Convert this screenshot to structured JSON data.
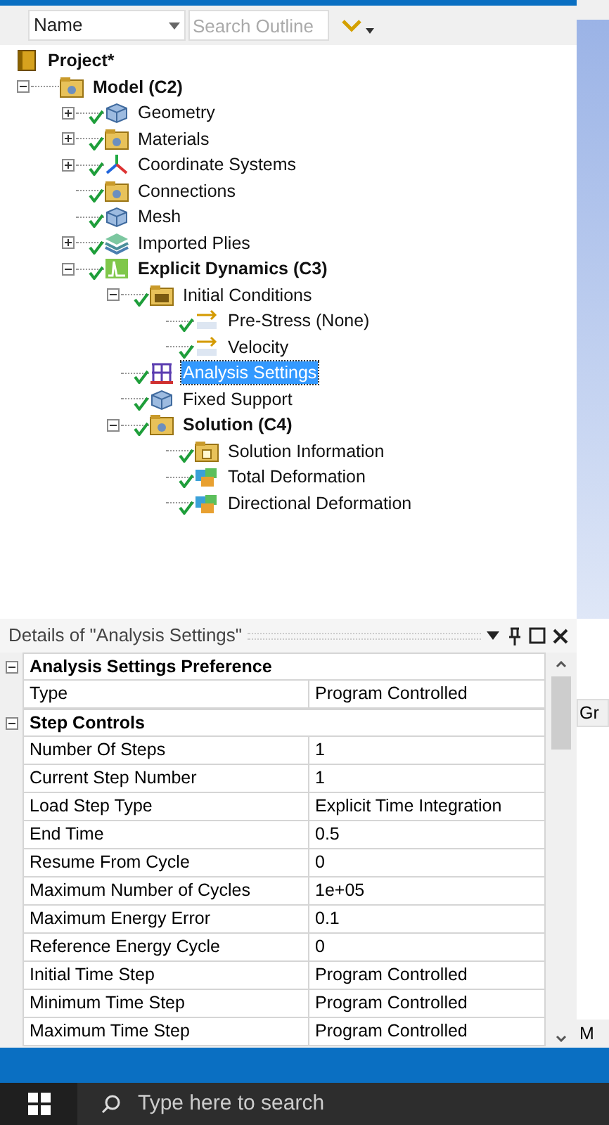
{
  "toolbar": {
    "sort_field": "Name",
    "search": {
      "placeholder": "Search Outline"
    }
  },
  "tree": [
    {
      "label": "Project*",
      "kind": "project",
      "checked": false,
      "selected": false,
      "children": [
        {
          "label": "Model (C2)",
          "kind": "model",
          "checked": false,
          "selected": false,
          "expanded": true,
          "children": [
            {
              "label": "Geometry",
              "kind": "geometry",
              "checked": true,
              "selected": false,
              "expanded": false
            },
            {
              "label": "Materials",
              "kind": "materials",
              "checked": true,
              "selected": false,
              "expanded": false
            },
            {
              "label": "Coordinate Systems",
              "kind": "coordinates",
              "checked": true,
              "selected": false,
              "expanded": false
            },
            {
              "label": "Connections",
              "kind": "connections",
              "checked": true,
              "selected": false
            },
            {
              "label": "Mesh",
              "kind": "mesh",
              "checked": true,
              "selected": false
            },
            {
              "label": "Imported Plies",
              "kind": "plies",
              "checked": true,
              "selected": false,
              "expanded": false
            },
            {
              "label": "Explicit Dynamics (C3)",
              "kind": "analysis",
              "checked": true,
              "selected": false,
              "expanded": true,
              "children": [
                {
                  "label": "Initial Conditions",
                  "kind": "conditions",
                  "checked": true,
                  "selected": false,
                  "expanded": true,
                  "children": [
                    {
                      "label": "Pre-Stress (None)",
                      "kind": "initial",
                      "checked": true,
                      "selected": false
                    },
                    {
                      "label": "Velocity",
                      "kind": "initial",
                      "checked": true,
                      "selected": false
                    }
                  ]
                },
                {
                  "label": "Analysis Settings",
                  "kind": "settings",
                  "checked": true,
                  "selected": true
                },
                {
                  "label": "Fixed Support",
                  "kind": "support",
                  "checked": true,
                  "selected": false
                },
                {
                  "label": "Solution (C4)",
                  "kind": "solution",
                  "checked": true,
                  "selected": false,
                  "expanded": true,
                  "children": [
                    {
                      "label": "Solution Information",
                      "kind": "info",
                      "checked": true,
                      "selected": false
                    },
                    {
                      "label": "Total Deformation",
                      "kind": "result",
                      "checked": true,
                      "selected": false
                    },
                    {
                      "label": "Directional Deformation",
                      "kind": "result",
                      "checked": true,
                      "selected": false
                    }
                  ]
                }
              ]
            }
          ]
        }
      ]
    }
  ],
  "details": {
    "title": "Details of \"Analysis Settings\"",
    "groups": [
      {
        "title": "Analysis Settings Preference",
        "expanded": true,
        "rows": [
          {
            "label": "Type",
            "value": "Program Controlled"
          }
        ]
      },
      {
        "title": "Step Controls",
        "expanded": true,
        "rows": [
          {
            "label": "Number Of Steps",
            "value": "1"
          },
          {
            "label": "Current Step Number",
            "value": "1"
          },
          {
            "label": "Load Step Type",
            "value": "Explicit Time Integration"
          },
          {
            "label": "End Time",
            "value": "0.5"
          },
          {
            "label": "Resume From Cycle",
            "value": "0"
          },
          {
            "label": "Maximum Number of Cycles",
            "value": "1e+05"
          },
          {
            "label": "Maximum Energy Error",
            "value": "0.1"
          },
          {
            "label": "Reference Energy Cycle",
            "value": "0"
          },
          {
            "label": "Initial Time Step",
            "value": "Program Controlled"
          },
          {
            "label": "Minimum Time Step",
            "value": "Program Controlled"
          },
          {
            "label": "Maximum Time Step",
            "value": "Program Controlled"
          }
        ]
      }
    ]
  },
  "side_panel": {
    "tab": "Gr",
    "label": "M"
  },
  "taskbar": {
    "search": {
      "placeholder": "Type here to search"
    }
  }
}
